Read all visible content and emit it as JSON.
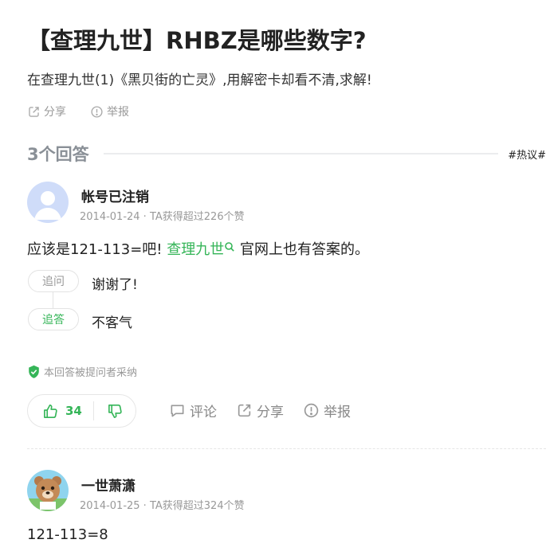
{
  "question": {
    "title": "【查理九世】RHBZ是哪些数字?",
    "description": "在查理九世(1)《黑贝街的亡灵》,用解密卡却看不清,求解!",
    "share_label": "分享",
    "report_label": "举报"
  },
  "answers_header": {
    "count_label": "3个回答",
    "tag": "#热议#"
  },
  "answers": [
    {
      "user": "帐号已注销",
      "meta": "2014-01-24 · TA获得超过226个赞",
      "content_before": "应该是121-113=吧!",
      "keyword": "查理九世",
      "content_after": "官网上也有答案的。",
      "followup_ask_label": "追问",
      "followup_ask_text": "谢谢了!",
      "followup_reply_label": "追答",
      "followup_reply_text": "不客气",
      "accepted_label": "本回答被提问者采纳",
      "likes": "34",
      "comment_label": "评论",
      "share_label": "分享",
      "report_label": "举报"
    },
    {
      "user": "一世萧潇",
      "meta": "2014-01-25 · TA获得超过324个赞",
      "content": "121-113=8"
    }
  ],
  "colors": {
    "accent_green": "#35b558",
    "muted_gray": "#999999"
  }
}
